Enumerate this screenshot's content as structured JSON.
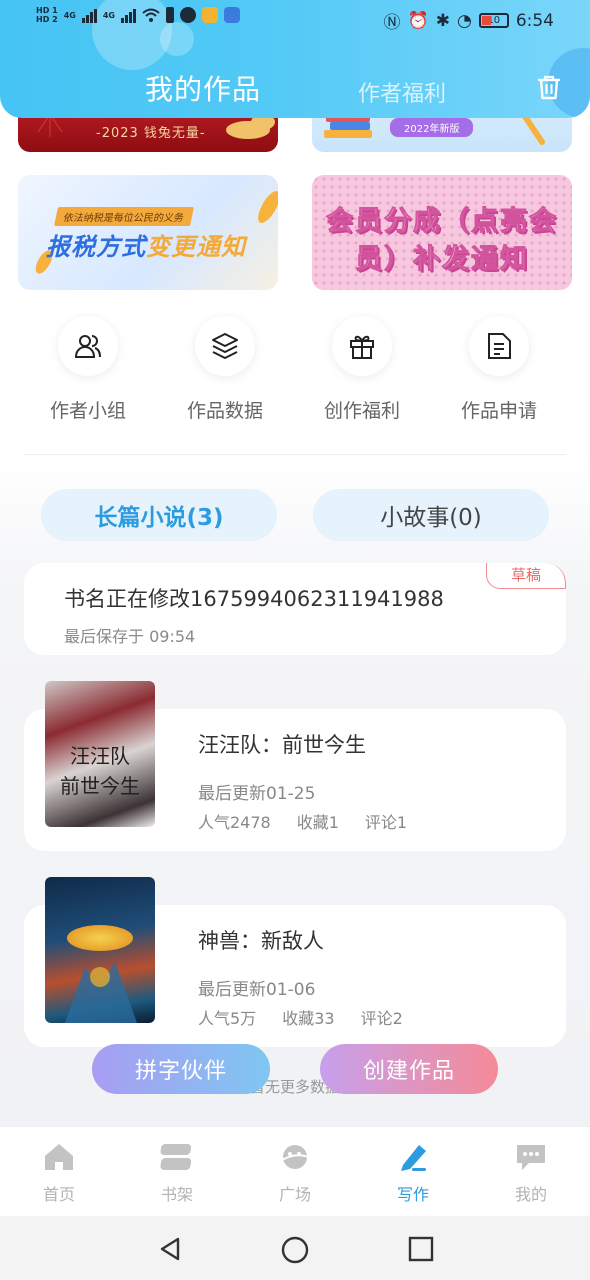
{
  "status_bar": {
    "left_labels": [
      "HD 1",
      "HD 2",
      "4G",
      "4G"
    ],
    "time": "6:54",
    "battery": "10"
  },
  "header": {
    "title": "我的作品",
    "tab_secondary": "作者福利"
  },
  "banners": {
    "b1_text": "-2023 钱兔无量-",
    "b2_pill": "2022年新版",
    "b3_small": "依法纳税是每位公民的义务",
    "b3_big_a": "报税方式",
    "b3_big_b": "变更通知",
    "b4_line1": "会员分成（点亮会",
    "b4_line2": "员）补发通知"
  },
  "quick_links": [
    {
      "label": "作者小组",
      "icon": "users-icon"
    },
    {
      "label": "作品数据",
      "icon": "layers-icon"
    },
    {
      "label": "创作福利",
      "icon": "gift-icon"
    },
    {
      "label": "作品申请",
      "icon": "document-icon"
    }
  ],
  "segments": {
    "long_novel": "长篇小说(3)",
    "short_story": "小故事(0)"
  },
  "draft": {
    "title": "书名正在修改1675994062311941988",
    "saved": "最后保存于 09:54",
    "tag": "草稿"
  },
  "novels": [
    {
      "title": "汪汪队：前世今生",
      "cover_text_1": "汪汪队",
      "cover_text_2": "前世今生",
      "updated": "最后更新01-25",
      "popularity": "人气2478",
      "favorites": "收藏1",
      "comments": "评论1"
    },
    {
      "title": "神兽：新敌人",
      "updated": "最后更新01-06",
      "popularity": "人气5万",
      "favorites": "收藏33",
      "comments": "评论2"
    }
  ],
  "no_more": "暂无更多数据",
  "actions": {
    "partner": "拼字伙伴",
    "create": "创建作品"
  },
  "bottom_nav": [
    {
      "label": "首页",
      "icon": "home-icon"
    },
    {
      "label": "书架",
      "icon": "bookshelf-icon"
    },
    {
      "label": "广场",
      "icon": "planet-icon"
    },
    {
      "label": "写作",
      "icon": "pen-icon",
      "active": true
    },
    {
      "label": "我的",
      "icon": "chat-bubble-icon"
    }
  ],
  "colors": {
    "accent": "#2c9be0",
    "header": "#52c9f6",
    "draft_tag": "#e86b6b"
  }
}
